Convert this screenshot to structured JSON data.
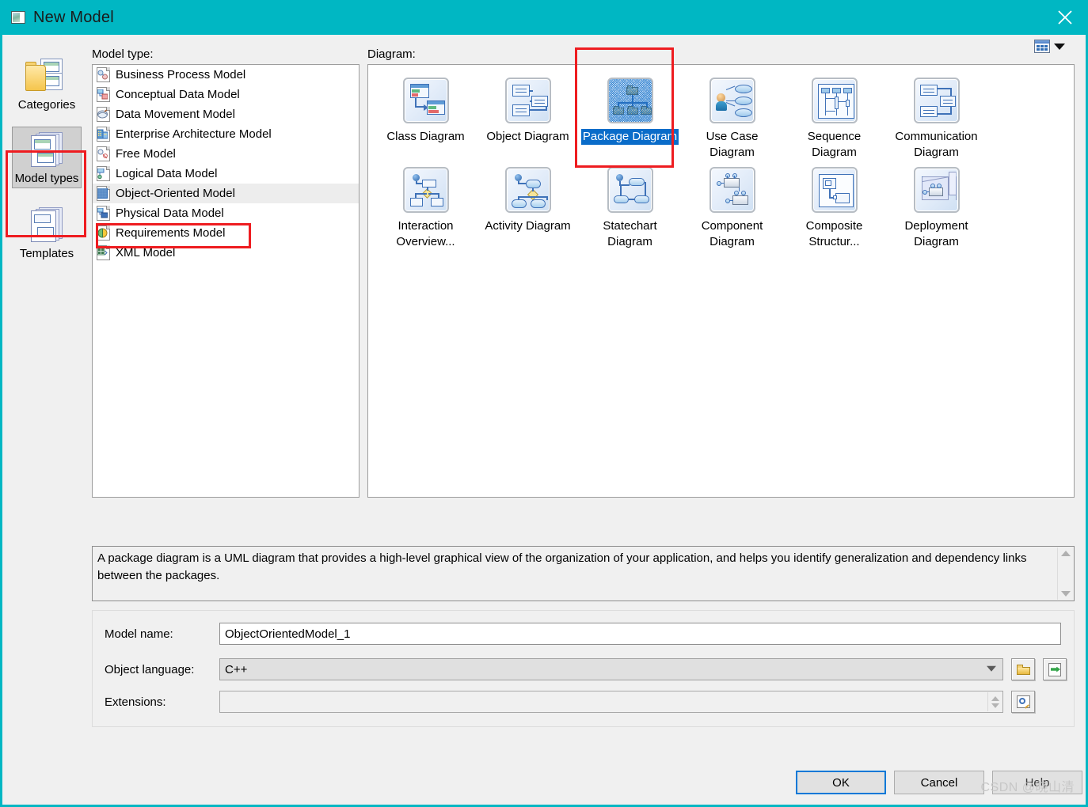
{
  "window": {
    "title": "New Model",
    "icon": "model-window-icon",
    "close_icon": "close-icon",
    "titlebar_color": "#00b7c3"
  },
  "view_toggle": {
    "icon": "list-view-icon",
    "caret_icon": "chevron-down-icon"
  },
  "rail": {
    "items": [
      {
        "label": "Categories",
        "icon": "categories-folder-icon",
        "selected": false
      },
      {
        "label": "Model types",
        "icon": "model-types-stack-icon",
        "selected": true
      },
      {
        "label": "Templates",
        "icon": "templates-pages-icon",
        "selected": false
      }
    ]
  },
  "model_type": {
    "label": "Model type:",
    "items": [
      {
        "label": "Business Process Model",
        "icon": "business-process-model-icon",
        "selected": false
      },
      {
        "label": "Conceptual Data Model",
        "icon": "conceptual-data-model-icon",
        "selected": false
      },
      {
        "label": "Data Movement Model",
        "icon": "data-movement-model-icon",
        "selected": false
      },
      {
        "label": "Enterprise Architecture Model",
        "icon": "enterprise-architecture-model-icon",
        "selected": false
      },
      {
        "label": "Free Model",
        "icon": "free-model-icon",
        "selected": false
      },
      {
        "label": "Logical Data Model",
        "icon": "logical-data-model-icon",
        "selected": false
      },
      {
        "label": "Object-Oriented Model",
        "icon": "object-oriented-model-icon",
        "selected": true
      },
      {
        "label": "Physical Data Model",
        "icon": "physical-data-model-icon",
        "selected": false
      },
      {
        "label": "Requirements Model",
        "icon": "requirements-model-icon",
        "selected": false
      },
      {
        "label": "XML Model",
        "icon": "xml-model-icon",
        "selected": false
      }
    ]
  },
  "diagram": {
    "label": "Diagram:",
    "selected_color": "#0a6cc9",
    "items": [
      {
        "label": "Class Diagram",
        "icon": "class-diagram-icon",
        "selected": false
      },
      {
        "label": "Object Diagram",
        "icon": "object-diagram-icon",
        "selected": false
      },
      {
        "label": "Package Diagram",
        "icon": "package-diagram-icon",
        "selected": true
      },
      {
        "label": "Use Case Diagram",
        "icon": "use-case-diagram-icon",
        "selected": false
      },
      {
        "label": "Sequence Diagram",
        "icon": "sequence-diagram-icon",
        "selected": false
      },
      {
        "label": "Communication Diagram",
        "icon": "communication-diagram-icon",
        "selected": false
      },
      {
        "label": "Interaction Overview...",
        "icon": "interaction-overview-icon",
        "selected": false
      },
      {
        "label": "Activity Diagram",
        "icon": "activity-diagram-icon",
        "selected": false
      },
      {
        "label": "Statechart Diagram",
        "icon": "statechart-diagram-icon",
        "selected": false
      },
      {
        "label": "Component Diagram",
        "icon": "component-diagram-icon",
        "selected": false
      },
      {
        "label": "Composite Structur...",
        "icon": "composite-structure-diagram-icon",
        "selected": false
      },
      {
        "label": "Deployment Diagram",
        "icon": "deployment-diagram-icon",
        "selected": false
      }
    ]
  },
  "description": {
    "text": "A package diagram is a UML diagram that provides a high-level graphical view of the organization of your application, and helps you identify generalization and dependency links between the packages."
  },
  "form": {
    "model_name_label": "Model name:",
    "model_name_value": "ObjectOrientedModel_1",
    "object_language_label": "Object language:",
    "object_language_value": "C++",
    "extensions_label": "Extensions:",
    "extensions_value": "",
    "browse_icon": "folder-open-icon",
    "import_icon": "import-file-icon",
    "properties_icon": "properties-magnifier-icon"
  },
  "footer": {
    "ok": "OK",
    "cancel": "Cancel",
    "help": "Help"
  },
  "watermark": "CSDN @晓山清"
}
